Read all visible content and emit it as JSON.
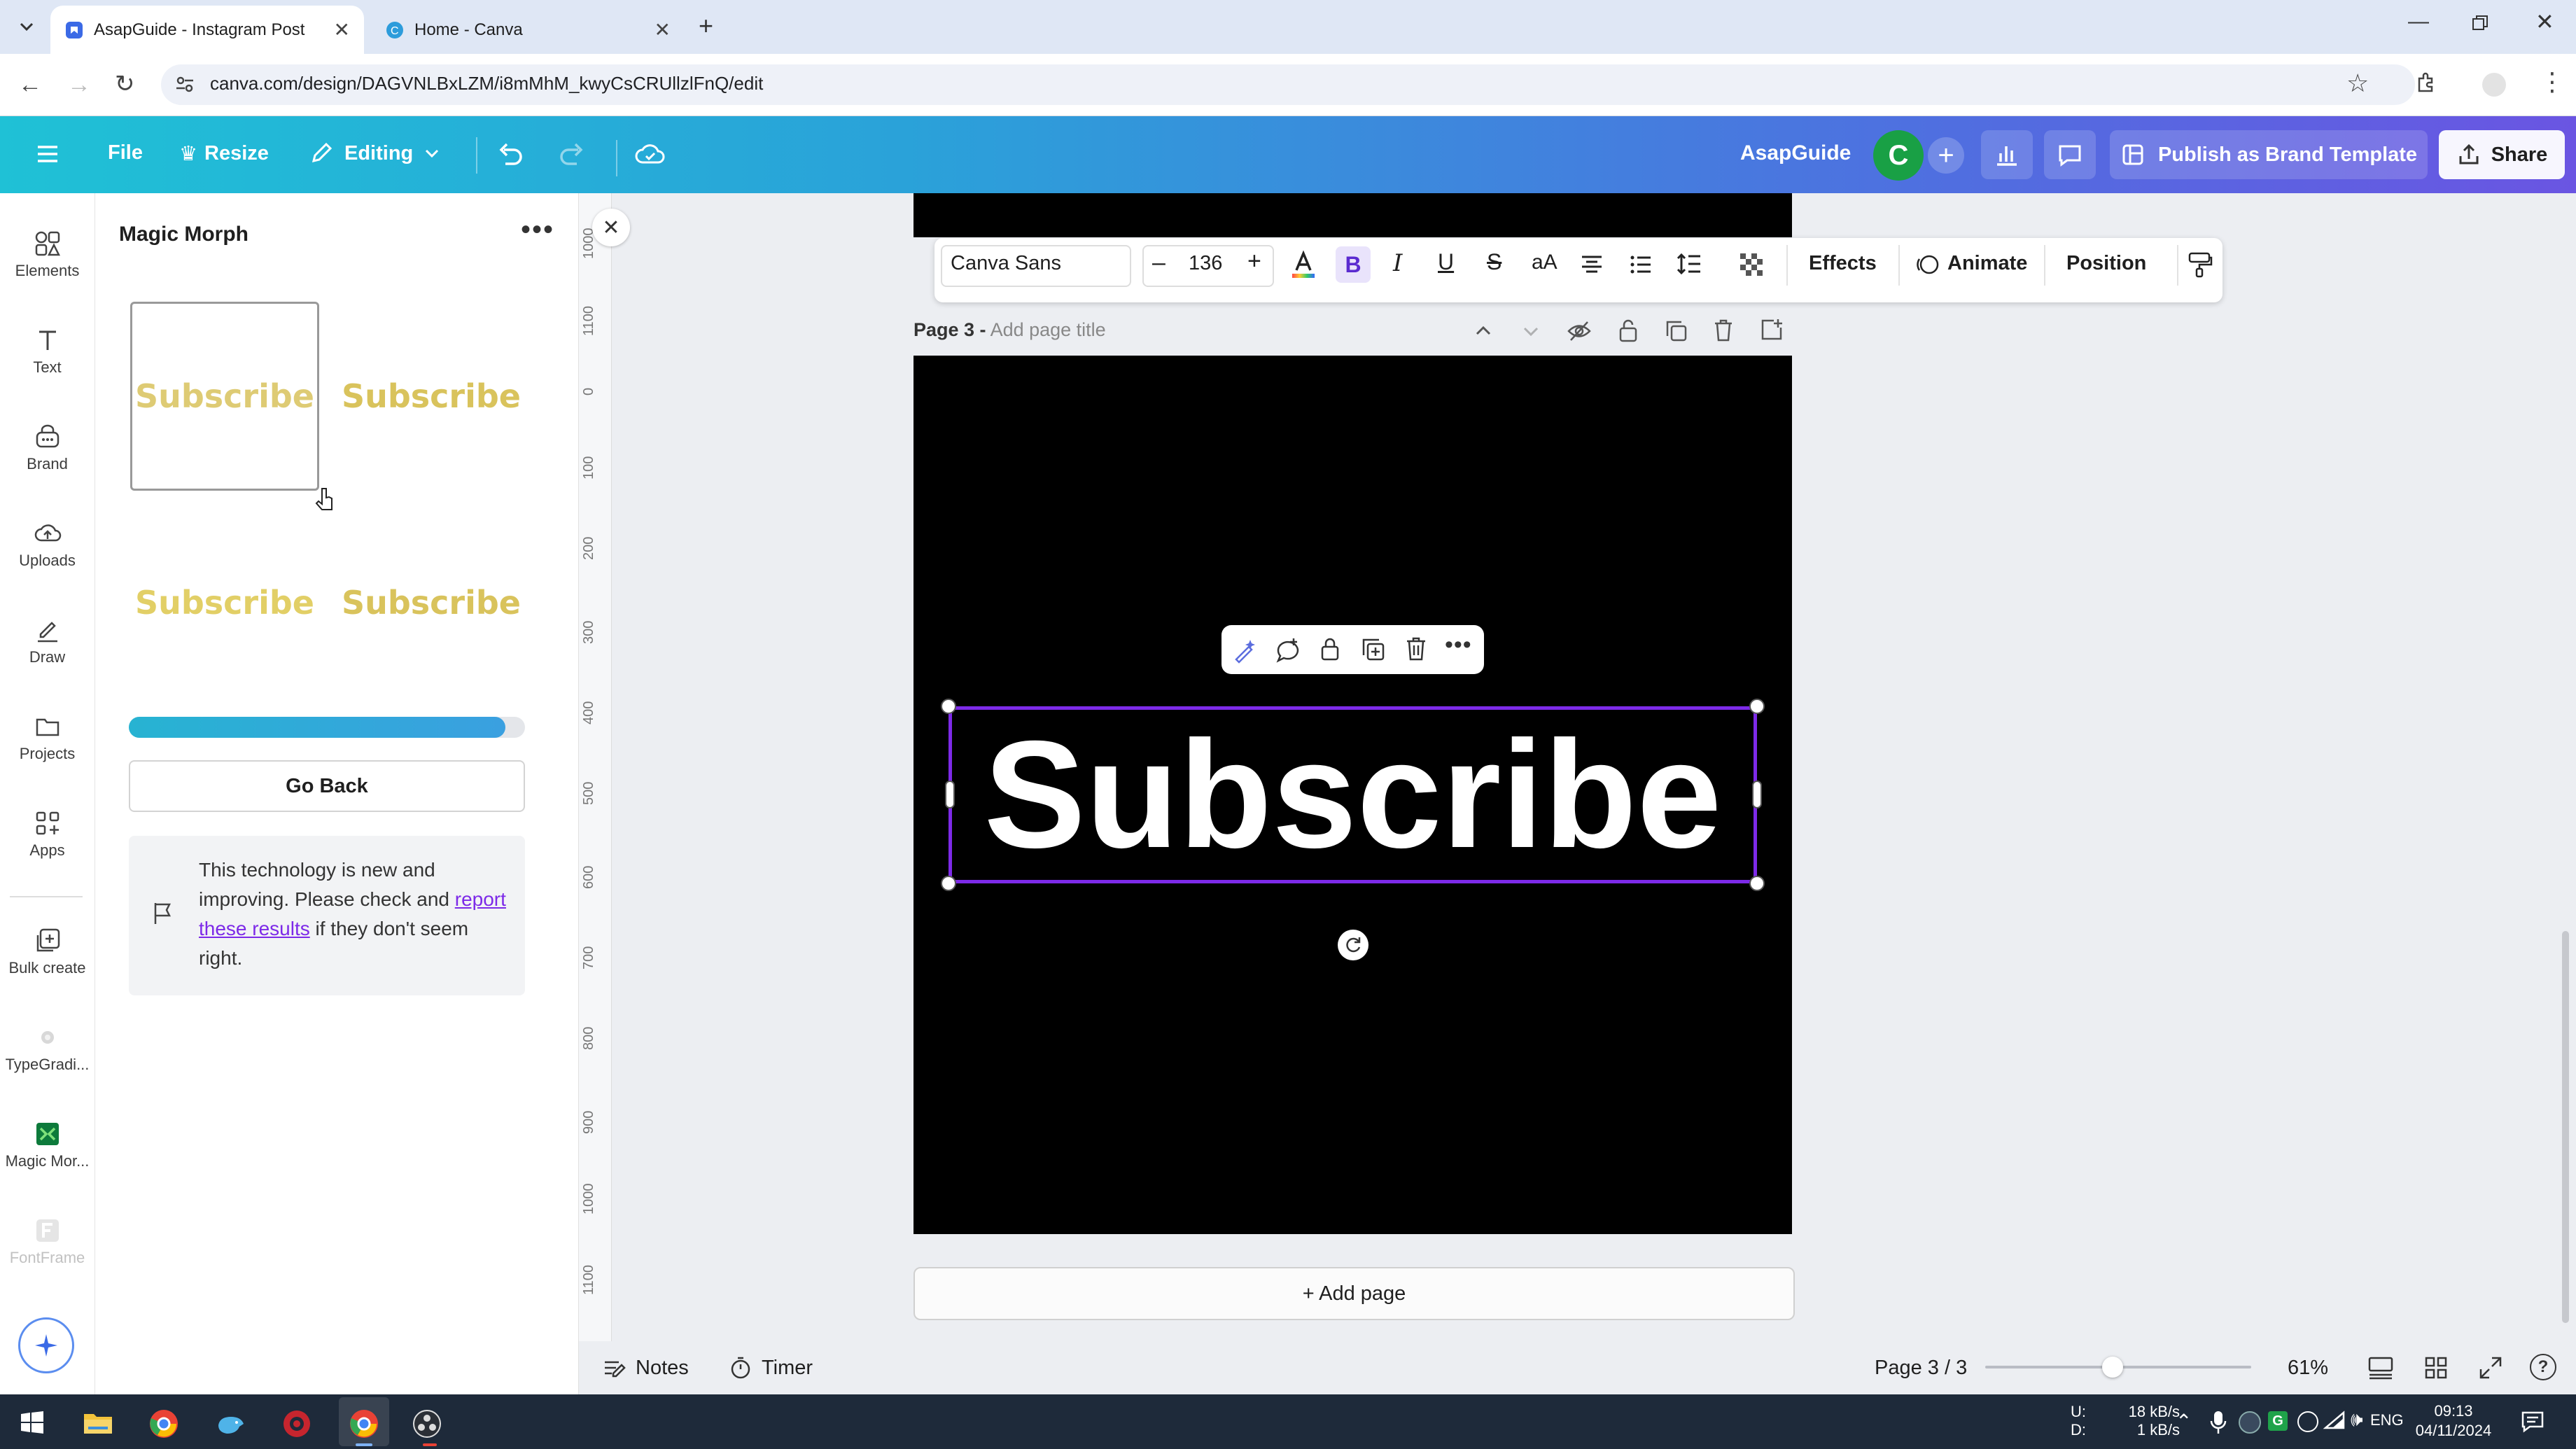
{
  "browser": {
    "tabs": [
      {
        "title": "AsapGuide - Instagram Post",
        "active": true
      },
      {
        "title": "Home - Canva",
        "active": false
      }
    ],
    "url": "canva.com/design/DAGVNLBxLZM/i8mMhM_kwyCsCRUllzlFnQ/edit"
  },
  "header": {
    "menu": [
      "File",
      "Resize",
      "Editing"
    ],
    "team_name": "AsapGuide",
    "avatar_initial": "C",
    "publish_label": "Publish as Brand Template",
    "share_label": "Share",
    "accent": "#7d2ae8"
  },
  "rail": {
    "items": [
      {
        "label": "Elements",
        "icon": "elements-icon"
      },
      {
        "label": "Text",
        "icon": "text-icon"
      },
      {
        "label": "Brand",
        "icon": "brand-icon"
      },
      {
        "label": "Uploads",
        "icon": "upload-cloud-icon"
      },
      {
        "label": "Draw",
        "icon": "pen-icon"
      },
      {
        "label": "Projects",
        "icon": "folder-icon"
      },
      {
        "label": "Apps",
        "icon": "apps-icon"
      },
      {
        "label": "Bulk create",
        "icon": "bulk-create-icon"
      },
      {
        "label": "TypeGradi...",
        "icon": "typegradient-icon"
      },
      {
        "label": "Magic Mor...",
        "icon": "magic-morph-icon"
      },
      {
        "label": "FontFrame",
        "icon": "fontframe-icon"
      }
    ]
  },
  "panel": {
    "title": "Magic Morph",
    "results": [
      "Subscribe",
      "Subscribe",
      "Subscribe",
      "Subscribe"
    ],
    "progress": 0.95,
    "go_back_label": "Go Back",
    "notice_pre": "This technology is new and improving. Please check and",
    "notice_link": "report these results",
    "notice_post": "if they don't seem right."
  },
  "text_toolbar": {
    "font": "Canva Sans",
    "size": "136",
    "effects_label": "Effects",
    "animate_label": "Animate",
    "position_label": "Position"
  },
  "page": {
    "label": "Page 3 -",
    "title_placeholder": "Add page title",
    "text": "Subscribe",
    "add_page_label": "+ Add page"
  },
  "ruler_ticks": [
    "1000",
    "1100",
    "0",
    "100",
    "200",
    "300",
    "400",
    "500",
    "600",
    "700",
    "800",
    "900",
    "1000",
    "1100"
  ],
  "bottom": {
    "notes_label": "Notes",
    "timer_label": "Timer",
    "page_indicator": "Page 3 / 3",
    "zoom": "61%",
    "zoom_fraction": 0.48
  },
  "taskbar": {
    "net_up": "18 kB/s",
    "net_down": "1 kB/s",
    "net_up_label": "U:",
    "net_down_label": "D:",
    "lang": "ENG",
    "time": "09:13",
    "date": "04/11/2024"
  }
}
